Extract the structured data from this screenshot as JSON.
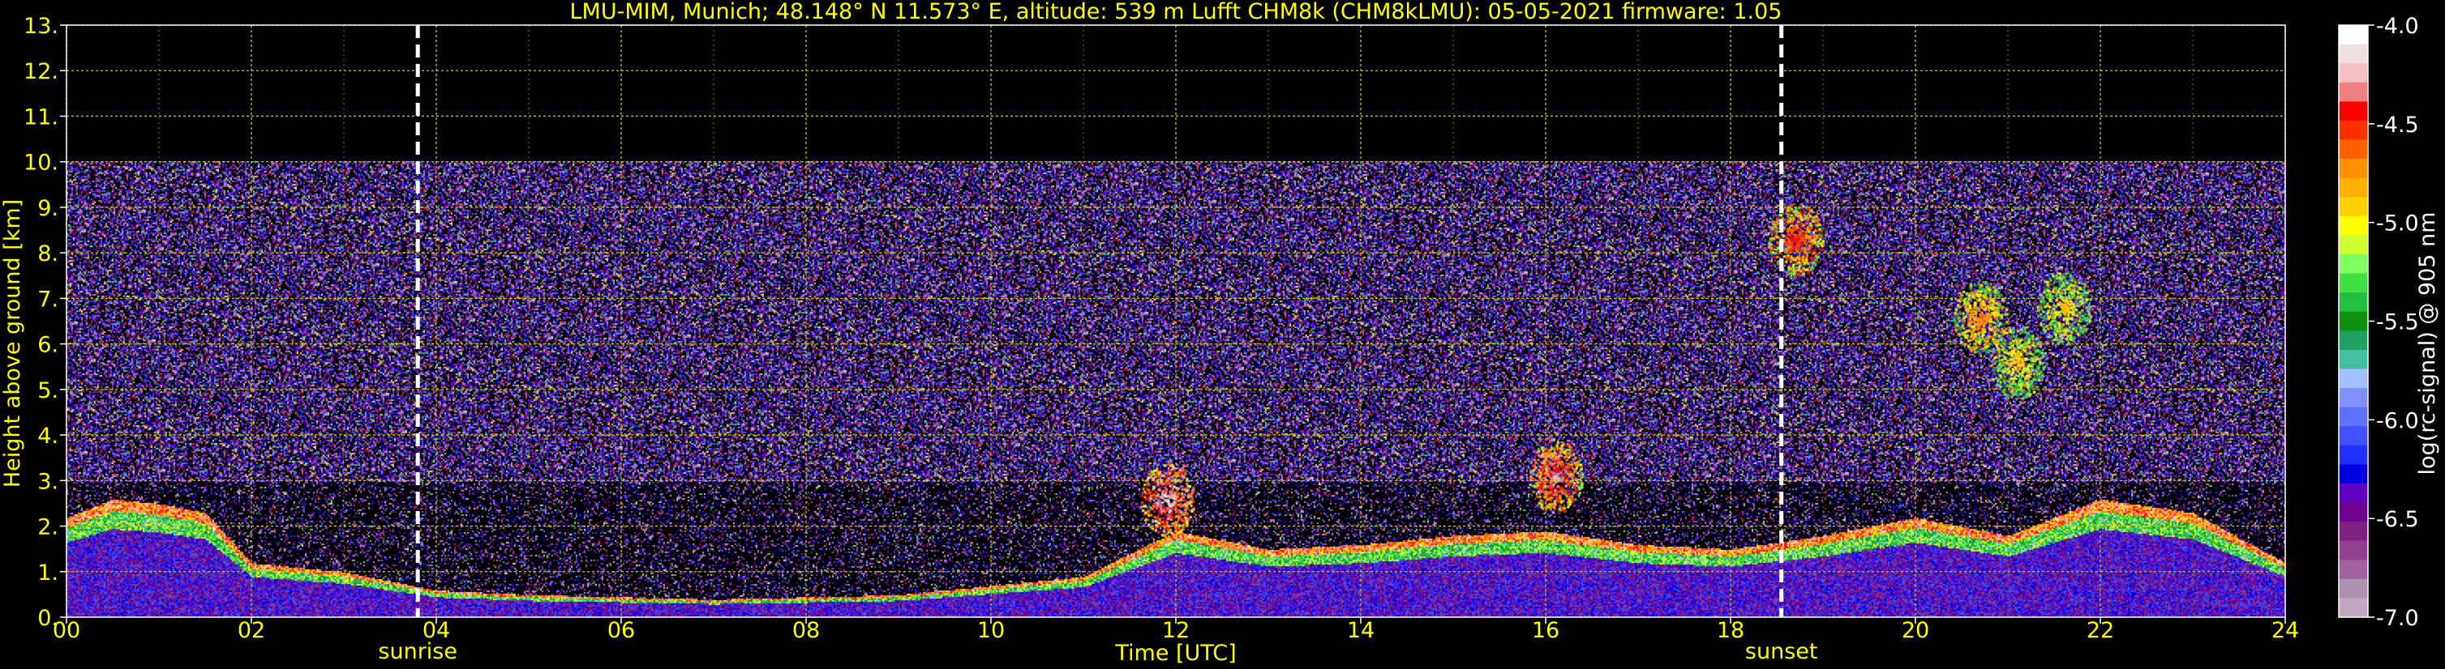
{
  "chart_data": {
    "type": "heatmap",
    "title": "LMU-MIM, Munich; 48.148° N 11.573° E, altitude: 539 m    Lufft CHM8k (CHM8kLMU): 05-05-2021    firmware: 1.05",
    "xlabel": "Time [UTC]",
    "ylabel": "Height above ground [km]",
    "xlim": [
      0,
      24
    ],
    "ylim": [
      0,
      13
    ],
    "x_ticks": [
      "00",
      "02",
      "04",
      "06",
      "08",
      "10",
      "12",
      "14",
      "16",
      "18",
      "20",
      "22",
      "24"
    ],
    "y_ticks": [
      "0.",
      "1.",
      "2.",
      "3.",
      "4.",
      "5.",
      "6.",
      "7.",
      "8.",
      "9.",
      "10.",
      "11.",
      "12.",
      "13."
    ],
    "grid": true,
    "data_max_height_km": 10,
    "markers": [
      {
        "label": "sunrise",
        "time": 3.8
      },
      {
        "label": "sunset",
        "time": 18.55
      }
    ],
    "colorbar": {
      "label": "log(rc-signal) @ 905 nm",
      "range": [
        -7.0,
        -4.0
      ],
      "ticks": [
        "-4.0",
        "-4.5",
        "-5.0",
        "-5.5",
        "-6.0",
        "-6.5",
        "-7.0"
      ],
      "colors": [
        "#ffffff",
        "#f0e0e0",
        "#f4c0c0",
        "#ee8080",
        "#ff0000",
        "#ff3000",
        "#ff6000",
        "#ff9000",
        "#ffb000",
        "#ffd000",
        "#ffff00",
        "#d0ff30",
        "#80ff60",
        "#40e040",
        "#20c040",
        "#109010",
        "#20a060",
        "#40c0a0",
        "#a0c0ff",
        "#8090ff",
        "#6070ff",
        "#4050ff",
        "#2030ff",
        "#0000e0",
        "#6000c0",
        "#700090",
        "#802080",
        "#904090",
        "#a060a0",
        "#b090b0",
        "#c0a8c0"
      ]
    },
    "features": {
      "boundary_layer_top": [
        {
          "t": 0.0,
          "h": 2.2
        },
        {
          "t": 0.5,
          "h": 2.6
        },
        {
          "t": 1.0,
          "h": 2.5
        },
        {
          "t": 1.5,
          "h": 2.3
        },
        {
          "t": 2.0,
          "h": 1.2
        },
        {
          "t": 3.0,
          "h": 1.0
        },
        {
          "t": 3.5,
          "h": 0.8
        },
        {
          "t": 4.0,
          "h": 0.6
        },
        {
          "t": 5.0,
          "h": 0.5
        },
        {
          "t": 6.0,
          "h": 0.45
        },
        {
          "t": 7.0,
          "h": 0.4
        },
        {
          "t": 8.0,
          "h": 0.45
        },
        {
          "t": 9.0,
          "h": 0.5
        },
        {
          "t": 10.0,
          "h": 0.7
        },
        {
          "t": 11.0,
          "h": 0.9
        },
        {
          "t": 12.0,
          "h": 1.9
        },
        {
          "t": 13.0,
          "h": 1.5
        },
        {
          "t": 14.0,
          "h": 1.6
        },
        {
          "t": 15.0,
          "h": 1.8
        },
        {
          "t": 16.0,
          "h": 1.9
        },
        {
          "t": 17.0,
          "h": 1.6
        },
        {
          "t": 18.0,
          "h": 1.5
        },
        {
          "t": 19.0,
          "h": 1.8
        },
        {
          "t": 20.0,
          "h": 2.2
        },
        {
          "t": 21.0,
          "h": 1.8
        },
        {
          "t": 22.0,
          "h": 2.6
        },
        {
          "t": 23.0,
          "h": 2.3
        },
        {
          "t": 24.0,
          "h": 1.2
        }
      ],
      "cloud_patches": [
        {
          "t": 11.9,
          "h": 2.6,
          "value": -4.1
        },
        {
          "t": 16.1,
          "h": 3.1,
          "value": -4.2
        },
        {
          "t": 18.7,
          "h": 8.3,
          "value": -4.4
        },
        {
          "t": 20.7,
          "h": 6.6,
          "value": -4.6
        },
        {
          "t": 21.1,
          "h": 5.6,
          "value": -4.8
        },
        {
          "t": 21.6,
          "h": 6.8,
          "value": -4.8
        }
      ]
    }
  }
}
